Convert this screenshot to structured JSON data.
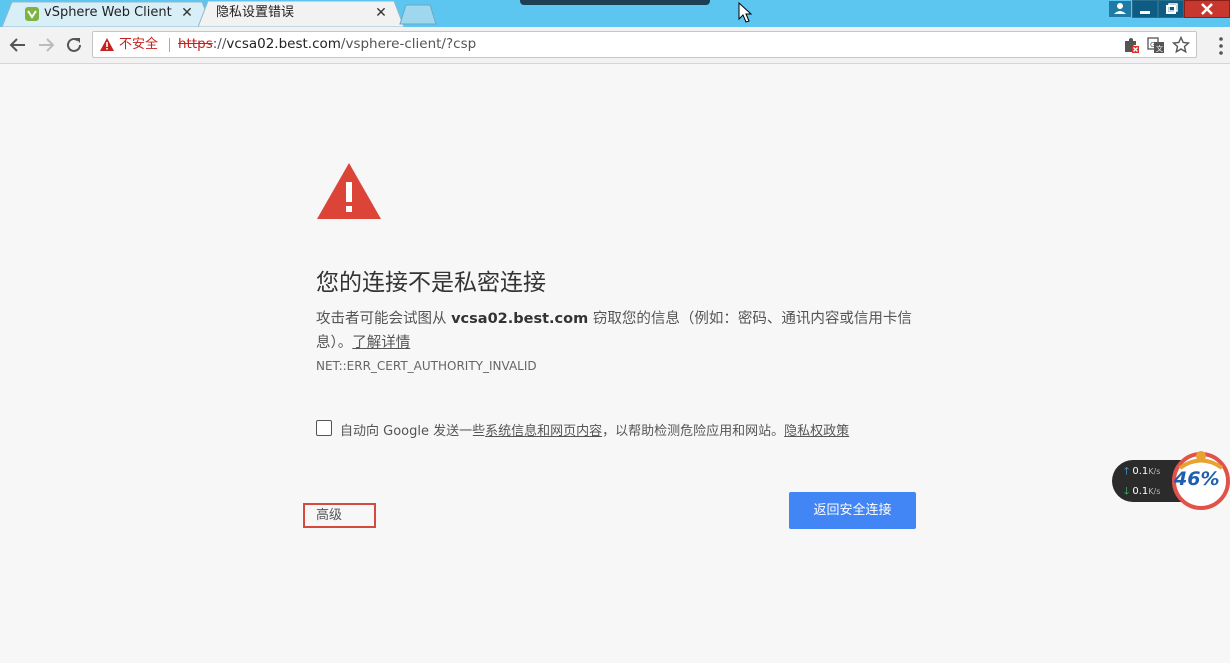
{
  "tabs": [
    {
      "label": "vSphere Web Client",
      "icon": "vsphere-icon",
      "active": false
    },
    {
      "label": "隐私设置错误",
      "active": true
    }
  ],
  "toolbar": {
    "security_label": "不安全",
    "url_scheme": "https",
    "url_host": "vcsa02.best.com",
    "url_path": "/vsphere-client/?csp"
  },
  "interstitial": {
    "heading": "您的连接不是私密连接",
    "body_prefix": "攻击者可能会试图从 ",
    "body_host": "vcsa02.best.com",
    "body_suffix": " 窃取您的信息（例如：密码、通讯内容或信用卡信息）。",
    "learn_more": "了解详情",
    "error_code": "NET::ERR_CERT_AUTHORITY_INVALID",
    "report_prefix": "自动向 Google 发送一些",
    "report_link": "系统信息和网页内容",
    "report_middle": "，以帮助检测危险应用和网站。",
    "privacy_link": "隐私权政策",
    "advanced_label": "高级",
    "back_label": "返回安全连接"
  },
  "netwidget": {
    "up_value": "0.1",
    "up_unit": "K/s",
    "down_value": "0.1",
    "down_unit": "K/s",
    "percent": "46%"
  },
  "colors": {
    "titlebar": "#5cc6f0",
    "alert_red": "#db4437",
    "button_blue": "#4285f4",
    "insecure_red": "#c5221f"
  }
}
